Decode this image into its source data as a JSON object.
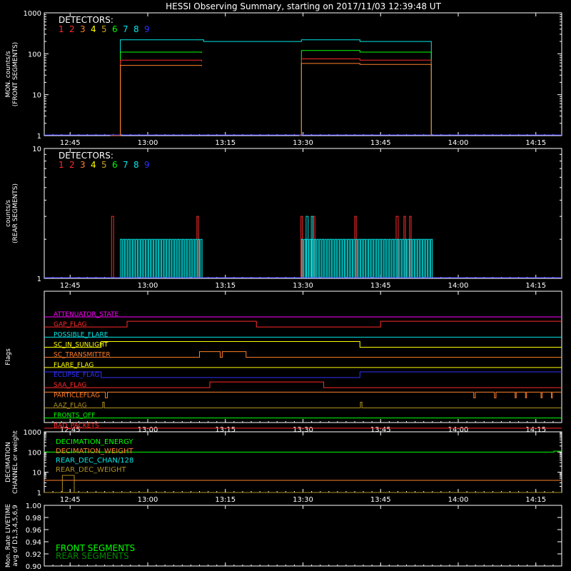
{
  "title": "HESSI Observing Summary, starting on 2017/11/03 12:39:48 UT",
  "x_axis": {
    "unit": "UT",
    "ticks": [
      "12:45",
      "13:00",
      "13:15",
      "13:30",
      "13:45",
      "14:00",
      "14:15"
    ],
    "xlim_minutes_from_1240": [
      0,
      100
    ]
  },
  "detectors": {
    "label": "DETECTORS:",
    "numbers": [
      "1",
      "2",
      "3",
      "4",
      "5",
      "6",
      "7",
      "8",
      "9"
    ],
    "colors": [
      "#ff2a2a",
      "#ff2a2a",
      "#ff7f2a",
      "#ffff00",
      "#c8a020",
      "#00ff00",
      "#00e8e8",
      "#00e8e8",
      "#3030ff"
    ]
  },
  "chart_data": [
    {
      "type": "line",
      "id": "front",
      "ylabel": "MON. counts/s\n(FRONT SEGMENTS)",
      "yscale": "log",
      "ylim": [
        1,
        1000
      ],
      "yticks": [
        "1",
        "10",
        "100",
        "1000"
      ],
      "series": [
        {
          "color": "#00e8e8",
          "segments": [
            {
              "x": [
                12.8,
                14.7,
                30.4,
                30.8,
                49.3,
                49.7,
                59.5,
                61.0,
                74.5,
                74.8
              ],
              "y": [
                1,
                220,
                220,
                200,
                200,
                220,
                220,
                200,
                200,
                1
              ]
            }
          ]
        },
        {
          "color": "#00ff00",
          "segments": [
            {
              "x": [
                12.8,
                14.7,
                30.4
              ],
              "y": [
                1,
                110,
                105
              ]
            },
            {
              "x": [
                49.3,
                49.7,
                61.0,
                74.8
              ],
              "y": [
                1,
                120,
                110,
                1
              ]
            }
          ]
        },
        {
          "color": "#ff2a2a",
          "segments": [
            {
              "x": [
                12.8,
                14.7,
                30.4
              ],
              "y": [
                1,
                70,
                65
              ]
            },
            {
              "x": [
                49.3,
                49.7,
                61.0,
                74.8
              ],
              "y": [
                1,
                75,
                70,
                1
              ]
            }
          ]
        },
        {
          "color": "#ff7f2a",
          "segments": [
            {
              "x": [
                12.8,
                14.7,
                30.4
              ],
              "y": [
                1,
                52,
                50
              ]
            },
            {
              "x": [
                49.3,
                49.7,
                61.0,
                74.8
              ],
              "y": [
                1,
                58,
                55,
                1
              ]
            }
          ]
        }
      ]
    },
    {
      "type": "line",
      "id": "rear",
      "ylabel": "counts/s\n(REAR SEGMENTS)",
      "yscale": "log",
      "ylim": [
        1,
        10
      ],
      "yticks": [
        "1",
        "10"
      ],
      "baseline_color": "#3030ff",
      "series": [
        {
          "color": "#ff2a2a",
          "pulses": [
            [
              13.0,
              13.4
            ],
            [
              29.5,
              29.8
            ],
            [
              49.6,
              49.9
            ],
            [
              52.0,
              52.3
            ],
            [
              60.0,
              60.3
            ],
            [
              68.0,
              68.4
            ],
            [
              69.5,
              69.8
            ],
            [
              70.6,
              70.9
            ]
          ],
          "level": 3
        },
        {
          "color": "#00e8e8",
          "pulses": [
            [
              50.6,
              51.0
            ],
            [
              51.6,
              51.9
            ]
          ],
          "level": 3
        },
        {
          "color": "#00e8e8",
          "bands": [
            [
              14.7,
              30.4
            ],
            [
              49.7,
              74.8
            ]
          ],
          "level": 2,
          "gap": 0.5
        }
      ]
    },
    {
      "type": "flags",
      "id": "flags",
      "ylabel": "Flags",
      "rows": [
        {
          "label": "ATTENUATOR_STATE",
          "color": "#ff00ff",
          "x": [
            0,
            100
          ],
          "y": [
            0,
            0
          ]
        },
        {
          "label": "GAP_FLAG",
          "color": "#ff2a2a",
          "x": [
            0,
            16,
            16,
            41,
            41,
            65,
            65,
            100
          ],
          "y": [
            0,
            0,
            1,
            1,
            0,
            0,
            1,
            1
          ]
        },
        {
          "label": "POSSIBLE_FLARE",
          "color": "#00e8e8",
          "x": [
            0,
            100
          ],
          "y": [
            0,
            0
          ]
        },
        {
          "label": "SC_IN_SUNLIGHT",
          "color": "#ffff00",
          "x": [
            0,
            11,
            11,
            61,
            61,
            100
          ],
          "y": [
            0,
            0,
            1,
            1,
            0,
            0
          ]
        },
        {
          "label": "SC_TRANSMITTER",
          "color": "#ff7f2a",
          "x": [
            0,
            30,
            30,
            34,
            34,
            34.4,
            34.4,
            39,
            39,
            100
          ],
          "y": [
            0,
            0,
            1,
            1,
            0,
            0,
            1,
            1,
            0,
            0
          ]
        },
        {
          "label": "FLARE_FLAG",
          "color": "#ffff00",
          "x": [
            0,
            100
          ],
          "y": [
            0,
            0
          ]
        },
        {
          "label": "ECLIPSE_FLAG",
          "color": "#3030ff",
          "x": [
            0,
            11,
            11,
            61,
            61,
            100
          ],
          "y": [
            1,
            1,
            0,
            0,
            1,
            1
          ]
        },
        {
          "label": "SAA_FLAG",
          "color": "#ff2a2a",
          "x": [
            0,
            32,
            32,
            54,
            54,
            100
          ],
          "y": [
            0,
            0,
            1,
            1,
            0,
            0
          ]
        },
        {
          "label": "PARTICLEFLAG",
          "color": "#ff7f2a",
          "x": [
            0,
            11.8,
            11.8,
            12.2,
            12.2,
            83,
            83,
            83.3,
            83.3,
            87,
            87,
            87.3,
            87.3,
            91,
            91,
            91.2,
            91.2,
            93,
            93,
            93.2,
            93.2,
            96,
            96,
            96.2,
            96.2,
            98,
            98,
            98.2,
            98.2,
            100
          ],
          "y": [
            1,
            1,
            0,
            0,
            1,
            1,
            0,
            0,
            1,
            1,
            0,
            0,
            1,
            1,
            0,
            0,
            1,
            1,
            0,
            0,
            1,
            1,
            0,
            0,
            1,
            1,
            0,
            0,
            1,
            1
          ]
        },
        {
          "label": "AAZ_FLAG",
          "color": "#b09020",
          "x": [
            0,
            11.3,
            11.3,
            11.6,
            11.6,
            61.1,
            61.1,
            61.4,
            61.4,
            100
          ],
          "y": [
            0,
            0,
            1,
            1,
            0,
            0,
            1,
            1,
            0,
            0
          ]
        },
        {
          "label": "FRONTS_OFF",
          "color": "#00ff00",
          "x": [
            0,
            100
          ],
          "y": [
            0,
            0
          ]
        },
        {
          "label": "BAD_PACKETS",
          "color": "#ff2a2a",
          "x": [
            0,
            100
          ],
          "y": [
            0,
            0
          ]
        }
      ]
    },
    {
      "type": "line",
      "id": "decimation",
      "ylabel": "DECIMATION\nCHANNEL or weight",
      "yscale": "log",
      "ylim": [
        1,
        1000
      ],
      "yticks": [
        "1",
        "10",
        "100",
        "1000"
      ],
      "legend": [
        {
          "label": "DECIMATION_ENERGY",
          "color": "#00ff00"
        },
        {
          "label": "DECIMATION_WEIGHT",
          "color": "#ff7f2a"
        },
        {
          "label": "REAR_DEC_CHAN/128",
          "color": "#00e8e8"
        },
        {
          "label": "REAR_DEC_WEIGHT",
          "color": "#b09020"
        }
      ],
      "series": [
        {
          "color": "#00ff00",
          "segments": [
            {
              "x": [
                0,
                98,
                98.5,
                100
              ],
              "y": [
                100,
                100,
                110,
                110
              ]
            }
          ]
        },
        {
          "color": "#ff7f2a",
          "segments": [
            {
              "x": [
                0,
                100
              ],
              "y": [
                4,
                4
              ]
            }
          ]
        },
        {
          "color": "#b09020",
          "segments": [
            {
              "x": [
                0,
                100
              ],
              "y": [
                1,
                1
              ]
            },
            {
              "x": [
                3.5,
                3.5,
                5.8,
                5.8
              ],
              "y": [
                1,
                7,
                7,
                1
              ]
            }
          ]
        }
      ]
    },
    {
      "type": "line",
      "id": "livetime",
      "ylabel": "Mon. Rate LIVETIME\navg of D1,3,4,5,6,9",
      "ylim": [
        0.9,
        1.0
      ],
      "yticks": [
        "0.90",
        "0.92",
        "0.94",
        "0.96",
        "0.98",
        "1.00"
      ],
      "legend": [
        {
          "label": "FRONT SEGMENTS",
          "color": "#00ff00"
        },
        {
          "label": "REAR SEGMENTS",
          "color": "#008800"
        }
      ],
      "series": []
    }
  ]
}
